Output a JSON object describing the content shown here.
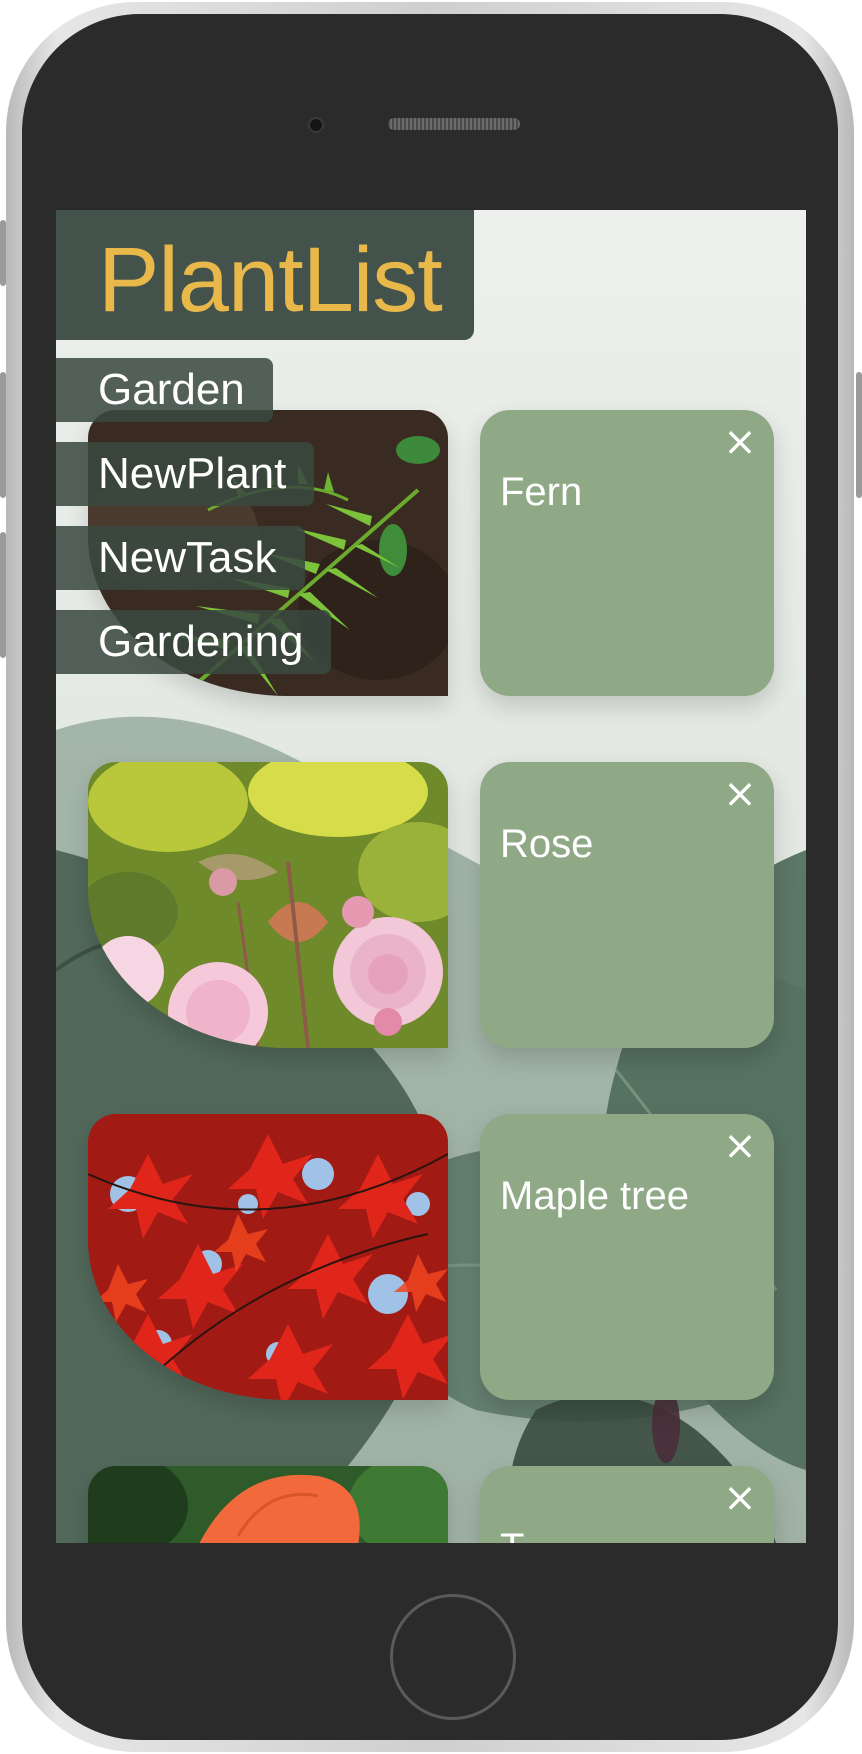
{
  "app": {
    "title": "PlantList",
    "title_color": "#e8b84a",
    "header_color": "#43524a",
    "card_color": "#8fa886"
  },
  "nav": {
    "items": [
      {
        "label": "Garden"
      },
      {
        "label": "NewPlant"
      },
      {
        "label": "NewTask"
      },
      {
        "label": "Gardening"
      }
    ]
  },
  "plants": [
    {
      "name": "Fern",
      "image": "fern-photo",
      "close_icon": "close-icon"
    },
    {
      "name": "Rose",
      "image": "rose-photo",
      "close_icon": "close-icon"
    },
    {
      "name": "Maple tree",
      "image": "maple-photo",
      "close_icon": "close-icon"
    },
    {
      "name": "T",
      "image": "flower-photo",
      "close_icon": "close-icon"
    }
  ],
  "icons": {
    "close": "×"
  }
}
